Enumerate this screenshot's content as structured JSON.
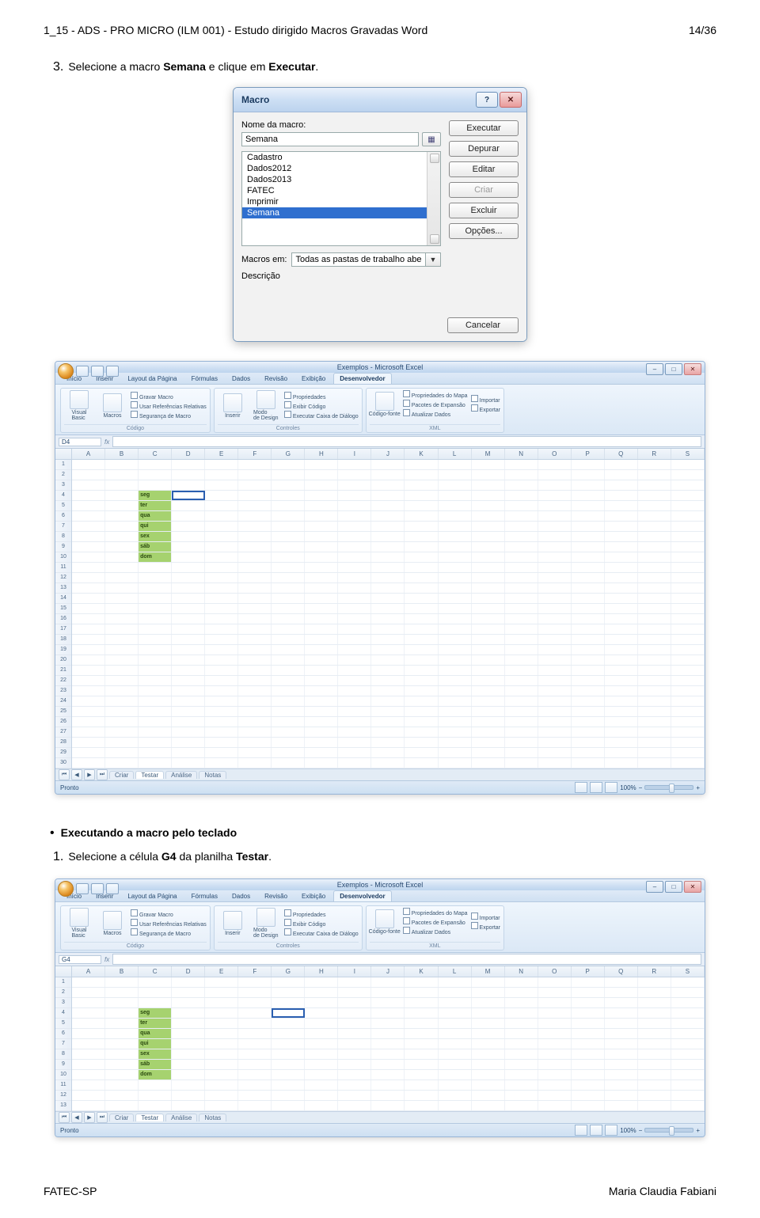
{
  "header": {
    "left": "1_15 - ADS - PRO MICRO (ILM 001) - Estudo dirigido Macros Gravadas Word",
    "right": "14/36"
  },
  "footer": {
    "left": "FATEC-SP",
    "right": "Maria Claudia Fabiani"
  },
  "body": {
    "step3_num": "3.",
    "step3_a": "Selecione a macro ",
    "step3_b": "Semana",
    "step3_c": " e clique em ",
    "step3_d": "Executar",
    "step3_e": ".",
    "bullet_title": "Executando a macro pelo teclado",
    "step1_num": "1.",
    "step1_a": "Selecione a célula ",
    "step1_b": "G4",
    "step1_c": " da planilha ",
    "step1_d": "Testar",
    "step1_e": "."
  },
  "dialog": {
    "title": "Macro",
    "help_glyph": "?",
    "close_glyph": "✕",
    "name_label": "Nome da macro:",
    "name_value": "Semana",
    "picker_glyph": "▦",
    "list": [
      "Cadastro",
      "Dados2012",
      "Dados2013",
      "FATEC",
      "Imprimir",
      "Semana"
    ],
    "buttons": {
      "executar": "Executar",
      "depurar": "Depurar",
      "editar": "Editar",
      "criar": "Criar",
      "excluir": "Excluir",
      "opcoes": "Opções...",
      "cancelar": "Cancelar"
    },
    "macros_em_label": "Macros em:",
    "macros_em_value": "Todas as pastas de trabalho abertas",
    "caret": "▼",
    "descricao_label": "Descrição"
  },
  "excel": {
    "title": "Exemplos - Microsoft Excel",
    "min": "–",
    "max": "□",
    "close": "✕",
    "tabs": [
      "Início",
      "Inserir",
      "Layout da Página",
      "Fórmulas",
      "Dados",
      "Revisão",
      "Exibição",
      "Desenvolvedor"
    ],
    "active_tab": "Desenvolvedor",
    "ribbon": {
      "codigo": {
        "visual": "Visual Basic",
        "macros": "Macros",
        "gravar": "Gravar Macro",
        "refrel": "Usar Referências Relativas",
        "seg": "Segurança de Macro",
        "title": "Código"
      },
      "controles": {
        "inserir": "Inserir",
        "modo": "Modo de Design",
        "prop": "Propriedades",
        "exibir": "Exibir Código",
        "exec": "Executar Caixa de Diálogo",
        "title": "Controles"
      },
      "xml": {
        "fonte": "Código-fonte",
        "mapa": "Propriedades do Mapa",
        "pacote": "Pacotes de Expansão",
        "atual": "Atualizar Dados",
        "imp": "Importar",
        "exp": "Exportar",
        "title": "XML"
      }
    },
    "columns": [
      "A",
      "B",
      "C",
      "D",
      "E",
      "F",
      "G",
      "H",
      "I",
      "J",
      "K",
      "L",
      "M",
      "N",
      "O",
      "P",
      "Q",
      "R",
      "S"
    ],
    "days": [
      "seg",
      "ter",
      "qua",
      "qui",
      "sex",
      "sáb",
      "dom"
    ],
    "sheet_tabs": [
      "Criar",
      "Testar",
      "Análise",
      "Notas"
    ],
    "status": "Pronto",
    "zoom": "100%",
    "v1": {
      "namebox": "D4",
      "rows": 30,
      "sel_col": 3,
      "sel_row": 3,
      "green_col": 2,
      "green_start": 3,
      "active_tab": "Testar"
    },
    "v2": {
      "namebox": "G4",
      "rows": 13,
      "sel_col": 6,
      "sel_row": 3,
      "green_col": 2,
      "green_start": 3,
      "active_tab": "Testar"
    }
  }
}
